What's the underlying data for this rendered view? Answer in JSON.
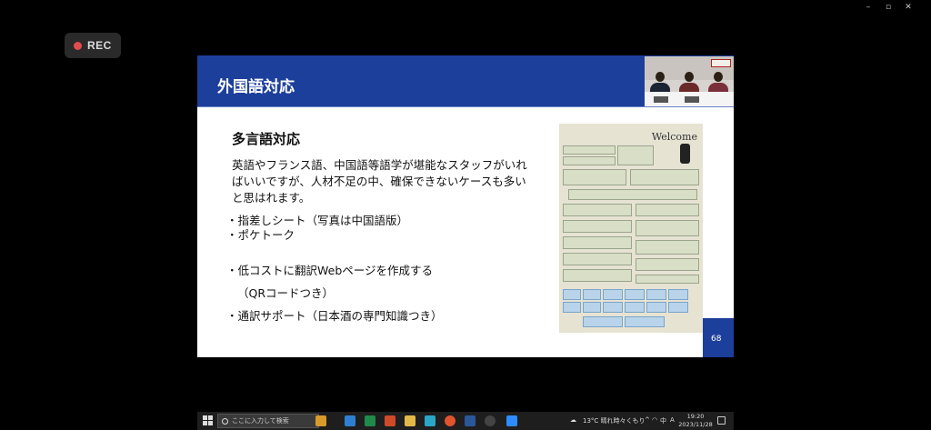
{
  "window": {
    "min": "–",
    "max": "▫",
    "close": "✕"
  },
  "rec": {
    "label": "REC"
  },
  "slide": {
    "title": "外国語対応",
    "subtitle": "多言語対応",
    "paragraph": [
      "英語やフランス語、中国語等語学が堪能なスタッフがいれ",
      "ばいいですが、人材不足の中、確保できないケースも多い",
      "と思はれます。"
    ],
    "bullets": [
      "・指差しシート（写真は中国語版）",
      "・ポケトーク",
      "・低コストに翻訳Webページを作成する",
      "（QRコードつき）",
      "・通訳サポート（日本酒の専門知識つき）"
    ],
    "photo_text": "Welcome",
    "page_number": "68"
  },
  "taskbar": {
    "search_placeholder": "ここに入力して検索",
    "weather": "13°C 晴れ時々くもり",
    "ime": "A",
    "ime_lang": "中",
    "time": "19:20",
    "date": "2023/11/28"
  },
  "colors": {
    "slide_header": "#1d3f9c",
    "rec_dot": "#e34c4c"
  }
}
